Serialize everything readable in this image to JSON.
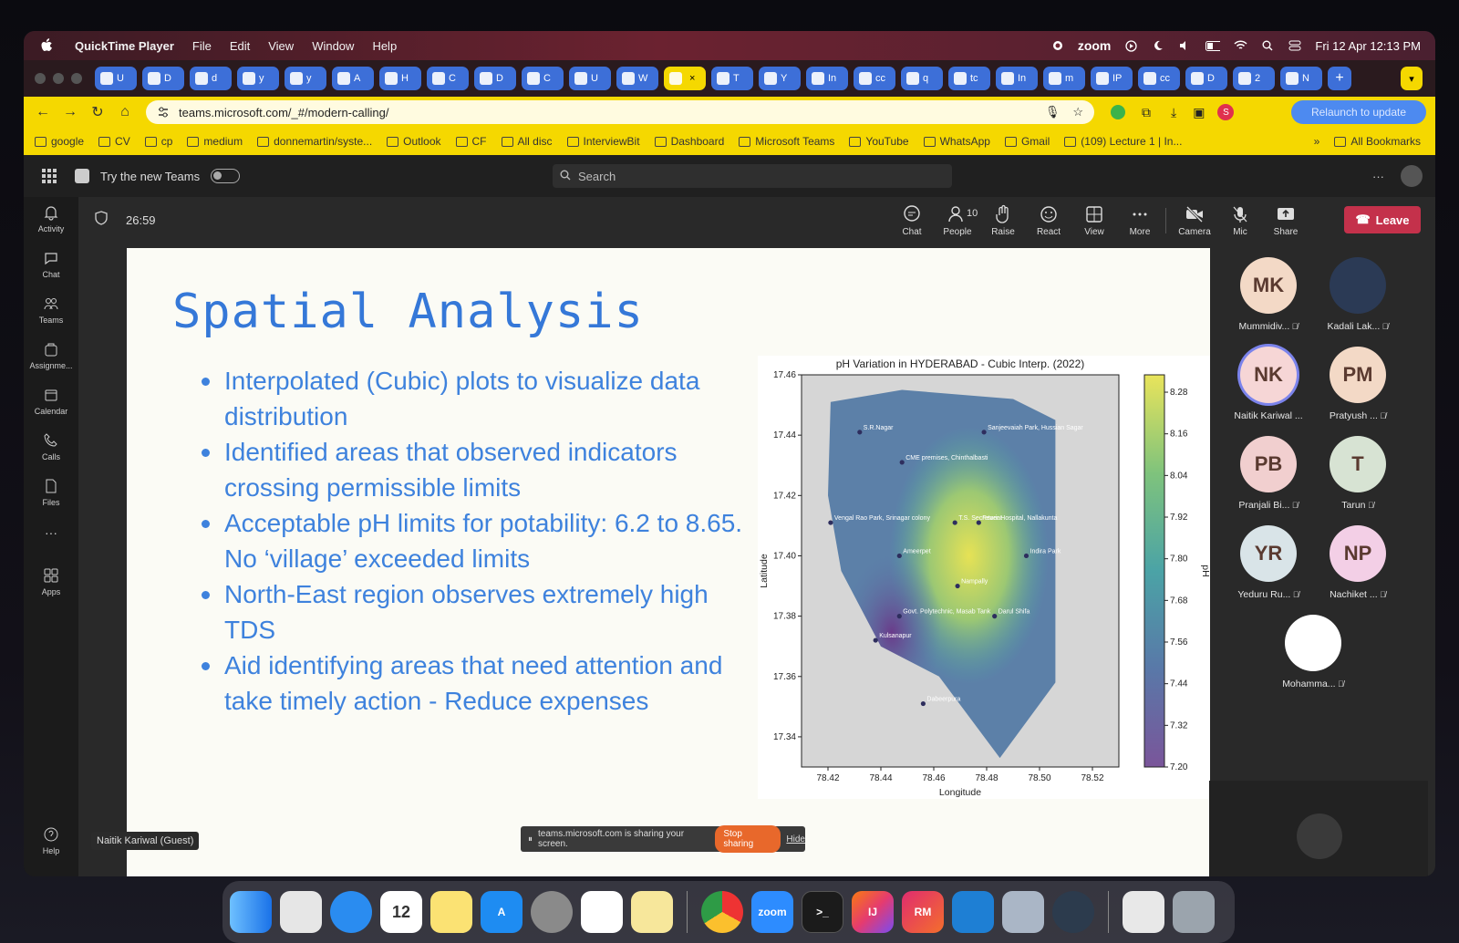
{
  "menubar": {
    "app_name": "QuickTime Player",
    "items": [
      "File",
      "Edit",
      "View",
      "Window",
      "Help"
    ],
    "zoom_label": "zoom",
    "datetime": "Fri 12 Apr  12:13 PM"
  },
  "browser": {
    "tabs": [
      "U",
      "D",
      "d",
      "y",
      "y",
      "A",
      "H",
      "C",
      "D",
      "C",
      "U",
      "W",
      "",
      "T",
      "Y",
      "In",
      "cc",
      "q",
      "tc",
      "In",
      "m",
      "IP",
      "cc",
      "D",
      "2",
      "N"
    ],
    "url": "teams.microsoft.com/_#/modern-calling/",
    "relaunch_label": "Relaunch to update",
    "profile_initial": "S",
    "bookmarks": [
      "google",
      "CV",
      "cp",
      "medium",
      "donnemartin/syste...",
      "Outlook",
      "CF",
      "All disc",
      "InterviewBit",
      "Dashboard",
      "Microsoft Teams",
      "YouTube",
      "WhatsApp",
      "Gmail",
      "(109) Lecture 1 | In..."
    ],
    "all_bookmarks_label": "All Bookmarks"
  },
  "teams": {
    "try_new_label": "Try the new Teams",
    "search_placeholder": "Search",
    "rail": [
      "Activity",
      "Chat",
      "Teams",
      "Assignme...",
      "Calendar",
      "Calls",
      "Files",
      "Apps",
      "Help"
    ],
    "timer": "26:59",
    "controls": {
      "chat": "Chat",
      "people": "People",
      "people_count": "10",
      "raise": "Raise",
      "react": "React",
      "view": "View",
      "more": "More",
      "camera": "Camera",
      "mic": "Mic",
      "share": "Share",
      "leave": "Leave"
    },
    "participants": [
      {
        "initials": "MK",
        "name": "Mummidiv...",
        "color": "#f3d9c6"
      },
      {
        "initials": "",
        "name": "Kadali Lak...",
        "color": "#2b3a55"
      },
      {
        "initials": "NK",
        "name": "Naitik Kariwal ...",
        "color": "#f6d6d6"
      },
      {
        "initials": "PM",
        "name": "Pratyush ...",
        "color": "#f3d9c6"
      },
      {
        "initials": "PB",
        "name": "Pranjali Bi...",
        "color": "#f1cfcf"
      },
      {
        "initials": "T",
        "name": "Tarun",
        "color": "#d7e3d3"
      },
      {
        "initials": "YR",
        "name": "Yeduru Ru...",
        "color": "#d9e4e8"
      },
      {
        "initials": "NP",
        "name": "Nachiket ...",
        "color": "#f3cfe6"
      },
      {
        "initials": "",
        "name": "Mohamma...",
        "color": "#ffffff"
      }
    ],
    "presenter_label": "Naitik Kariwal (Guest)",
    "share_notice": "teams.microsoft.com is sharing your screen.",
    "stop_sharing": "Stop sharing",
    "hide": "Hide"
  },
  "slide": {
    "title": "Spatial Analysis",
    "bullets": [
      "Interpolated (Cubic) plots to visualize data distribution",
      "Identified areas that observed indicators crossing permissible limits",
      "Acceptable pH limits for potability: 6.2 to 8.65. No ‘village’ exceeded limits",
      "North-East region observes extremely high TDS",
      "Aid identifying areas that need attention and take timely action - Reduce expenses"
    ]
  },
  "chart_data": {
    "type": "heatmap",
    "title": "pH Variation in HYDERABAD - Cubic Interp. (2022)",
    "xlabel": "Longitude",
    "ylabel": "Latitude",
    "colorbar_label": "pH",
    "xlim": [
      78.41,
      78.53
    ],
    "ylim": [
      17.33,
      17.46
    ],
    "x_ticks": [
      "78.42",
      "78.44",
      "78.46",
      "78.48",
      "78.50",
      "78.52"
    ],
    "y_ticks": [
      "17.46",
      "17.44",
      "17.42",
      "17.40",
      "17.38",
      "17.36",
      "17.34"
    ],
    "colorbar_ticks": [
      "8.28",
      "8.16",
      "8.04",
      "7.92",
      "7.80",
      "7.68",
      "7.56",
      "7.44",
      "7.32",
      "7.20"
    ],
    "colorbar_range": [
      7.2,
      8.33
    ],
    "colormap": "viridis",
    "locations": [
      {
        "name": "S.R.Nagar",
        "x": 78.432,
        "y": 17.441
      },
      {
        "name": "Sanjeevaiah Park, Hussian Sagar",
        "x": 78.479,
        "y": 17.441
      },
      {
        "name": "CME premises, Chinthalbasti",
        "x": 78.448,
        "y": 17.431
      },
      {
        "name": "Vengal Rao Park, Srinagar colony",
        "x": 78.421,
        "y": 17.411
      },
      {
        "name": "T.S. Secretariat",
        "x": 78.468,
        "y": 17.411
      },
      {
        "name": "Fever Hospital, Nallakunta",
        "x": 78.477,
        "y": 17.411
      },
      {
        "name": "Ameerpet",
        "x": 78.447,
        "y": 17.4
      },
      {
        "name": "Indira Park",
        "x": 78.495,
        "y": 17.4
      },
      {
        "name": "Nampally",
        "x": 78.469,
        "y": 17.39
      },
      {
        "name": "Govt. Polytechnic, Masab Tank",
        "x": 78.447,
        "y": 17.38
      },
      {
        "name": "Darul Shifa",
        "x": 78.483,
        "y": 17.38
      },
      {
        "name": "Kulsanapur",
        "x": 78.438,
        "y": 17.372
      },
      {
        "name": "Dabeerpura",
        "x": 78.456,
        "y": 17.351
      }
    ]
  }
}
